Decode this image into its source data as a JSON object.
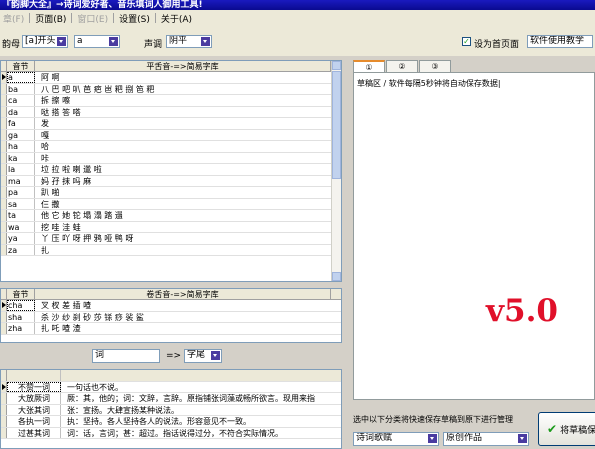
{
  "window": {
    "title": "『韵脚大全』→诗词爱好者、音乐填词人御用工具!"
  },
  "menu": [
    {
      "label": "章(F)",
      "enabled": false
    },
    {
      "label": "页面(B)",
      "enabled": true
    },
    {
      "label": "窗口(E)",
      "enabled": false
    },
    {
      "label": "设置(S)",
      "enabled": true
    },
    {
      "label": "关于(A)",
      "enabled": true
    }
  ],
  "toolbar": {
    "yunmu_label": "韵母",
    "filter_value": "[a]开头",
    "letter_value": "a",
    "tone_label": "声调",
    "tone_value": "阴平",
    "homepage_label": "设为首页面",
    "homepage_checked": true,
    "help_label": "软件使用教学"
  },
  "upper_grid": {
    "headers": [
      "音节",
      "平舌音-=>简易字库"
    ],
    "rows": [
      {
        "syllable": "a",
        "chars": "阿 啊",
        "selected": true
      },
      {
        "syllable": "ba",
        "chars": "八 巴 吧 叭 芭 疤 岜 粑 捌 笆 粑"
      },
      {
        "syllable": "ca",
        "chars": "拆 擦 嚓"
      },
      {
        "syllable": "da",
        "chars": "哒 搭 答 嗒"
      },
      {
        "syllable": "fa",
        "chars": "发"
      },
      {
        "syllable": "ga",
        "chars": "嘎"
      },
      {
        "syllable": "ha",
        "chars": "哈"
      },
      {
        "syllable": "ka",
        "chars": "咔"
      },
      {
        "syllable": "la",
        "chars": "垃 拉 啦 喇 邋 啦"
      },
      {
        "syllable": "ma",
        "chars": "妈 孖 抹 吗 麻"
      },
      {
        "syllable": "pa",
        "chars": "趴 啪"
      },
      {
        "syllable": "sa",
        "chars": "仨 撒"
      },
      {
        "syllable": "ta",
        "chars": "他 它 她 铊 塌 溻 踏 遢"
      },
      {
        "syllable": "wa",
        "chars": "挖 哇 洼 蛙"
      },
      {
        "syllable": "ya",
        "chars": "丫 压 吖 呀 押 鸦 哑 鸭 呀"
      },
      {
        "syllable": "za",
        "chars": "扎"
      }
    ]
  },
  "middle_grid": {
    "headers": [
      "音节",
      "卷舌音-=>简易字库"
    ],
    "rows": [
      {
        "syllable": "cha",
        "chars": "叉 杈 差 插 喳",
        "selected": true
      },
      {
        "syllable": "sha",
        "chars": "杀 沙 纱 刹 砂 莎 铩 痧 裟 鲨"
      },
      {
        "syllable": "zha",
        "chars": "扎 吒 喳 渣"
      }
    ]
  },
  "search": {
    "query": "词",
    "arrow": "=>",
    "mode_value": "字尾"
  },
  "lower_grid": {
    "rows": [
      {
        "word": "",
        "meaning": ""
      },
      {
        "word": "不赞一词",
        "meaning": "一句话也不说。"
      },
      {
        "word": "大放厥词",
        "meaning": "厥：其，他的；词：文辞，言辞。原指铺张词藻或畅所欲言。现用来指"
      },
      {
        "word": "大张其词",
        "meaning": "张：宣扬。大肆宣扬某种说法。"
      },
      {
        "word": "各执一词",
        "meaning": "执：坚持。各人坚持各人的说法。形容意见不一致。"
      },
      {
        "word": "过甚其词",
        "meaning": "词：话，言词；甚：超过。指话说得过分，不符合实际情况。"
      }
    ]
  },
  "right_panel": {
    "tabs": [
      "①",
      "②",
      "③"
    ],
    "active_tab": 0,
    "draft_text": "草稿区 / 软件每隔5秒钟将自动保存数据|",
    "version_text": "v5.0",
    "save_prompt": "选中以下分类将快速保存草稿到原下进行管理",
    "category_value": "诗词歌赋",
    "type_value": "原创作品",
    "save_button_label": "将草稿保存"
  },
  "colors": {
    "title_bar": "#0a0a90",
    "version_red": "#e0102a",
    "tab_accent": "#e68b2c",
    "combo_arrow": "#4a3ba0"
  }
}
